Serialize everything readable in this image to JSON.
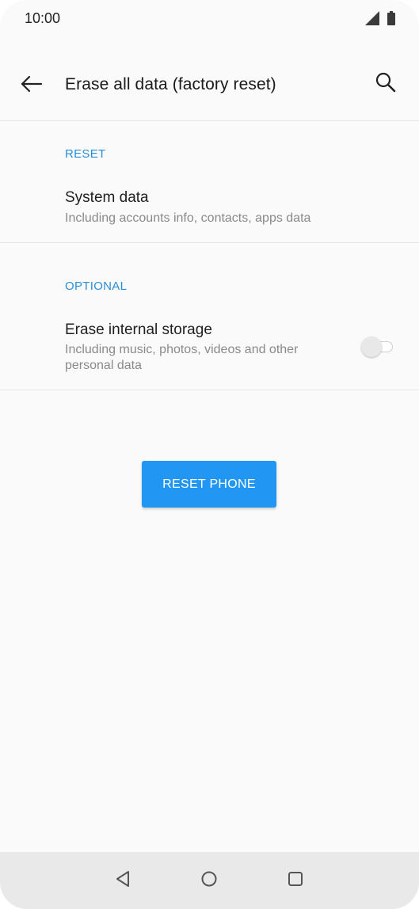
{
  "status_bar": {
    "time": "10:00",
    "icons": [
      "signal-icon",
      "battery-icon"
    ]
  },
  "app_bar": {
    "title": "Erase all data (factory reset)",
    "back_icon": "back-arrow-icon",
    "search_icon": "search-icon"
  },
  "sections": {
    "reset": {
      "header": "RESET",
      "item_title": "System data",
      "item_summary": "Including accounts info, contacts, apps data"
    },
    "optional": {
      "header": "OPTIONAL",
      "item_title": "Erase internal storage",
      "item_summary": "Including music, photos, videos and other personal data",
      "toggle_on": false
    }
  },
  "action": {
    "reset_label": "RESET PHONE",
    "color": "#2196f3"
  },
  "nav_bar": {
    "icons": [
      "back-triangle-icon",
      "home-circle-icon",
      "recents-square-icon"
    ]
  },
  "colors": {
    "accent": "#2a8fd8",
    "background": "#fafafa"
  }
}
